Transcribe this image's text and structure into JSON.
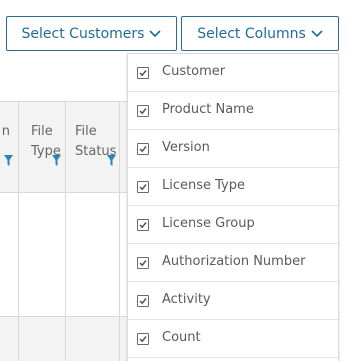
{
  "toolbar": {
    "customers_label": "Select Customers",
    "columns_label": "Select Columns",
    "accent_color": "#1f6d94"
  },
  "table": {
    "headers": [
      {
        "text": "n"
      },
      {
        "text": "File\nType"
      },
      {
        "text": "File\nStatus"
      }
    ],
    "filter_icon": "funnel-icon"
  },
  "columns_menu": {
    "items": [
      {
        "label": "Customer",
        "checked": true
      },
      {
        "label": "Product Name",
        "checked": true
      },
      {
        "label": "Version",
        "checked": true
      },
      {
        "label": "License Type",
        "checked": true
      },
      {
        "label": "License Group",
        "checked": true
      },
      {
        "label": "Authorization Number",
        "checked": true
      },
      {
        "label": "Activity",
        "checked": true
      },
      {
        "label": "Count",
        "checked": true
      }
    ]
  }
}
